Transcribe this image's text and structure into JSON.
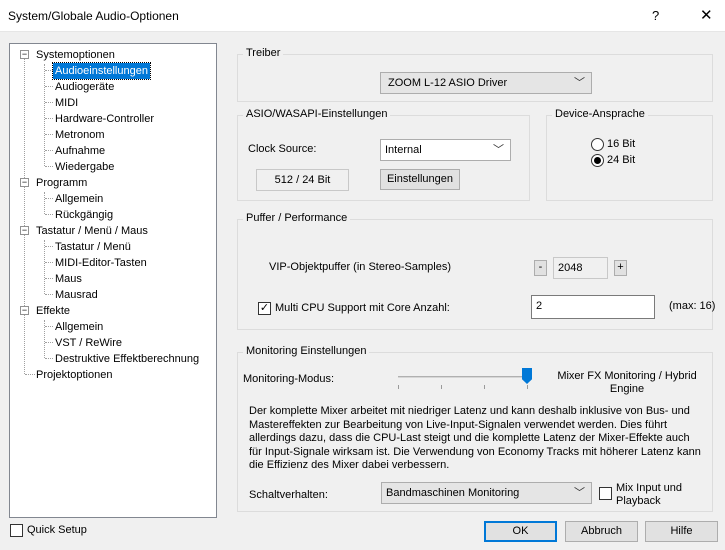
{
  "window": {
    "title": "System/Globale Audio-Optionen",
    "help": "?",
    "close": "✕"
  },
  "tree": {
    "items": [
      {
        "label": "Systemoptionen"
      },
      {
        "label": "Audioeinstellungen"
      },
      {
        "label": "Audiogeräte"
      },
      {
        "label": "MIDI"
      },
      {
        "label": "Hardware-Controller"
      },
      {
        "label": "Metronom"
      },
      {
        "label": "Aufnahme"
      },
      {
        "label": "Wiedergabe"
      },
      {
        "label": "Programm"
      },
      {
        "label": "Allgemein"
      },
      {
        "label": "Rückgängig"
      },
      {
        "label": "Tastatur / Menü / Maus"
      },
      {
        "label": "Tastatur / Menü"
      },
      {
        "label": "MIDI-Editor-Tasten"
      },
      {
        "label": "Maus"
      },
      {
        "label": "Mausrad"
      },
      {
        "label": "Effekte"
      },
      {
        "label": "Allgemein"
      },
      {
        "label": "VST / ReWire"
      },
      {
        "label": "Destruktive Effektberechnung"
      },
      {
        "label": "Projektoptionen"
      }
    ],
    "toggle": "−"
  },
  "treiber": {
    "title": "Treiber",
    "driver": "ZOOM L-12 ASIO Driver"
  },
  "asio": {
    "title": "ASIO/WASAPI-Einstellungen",
    "clock_label": "Clock Source:",
    "clock_value": "Internal",
    "buffer_value": "512 / 24 Bit",
    "settings_button": "Einstellungen"
  },
  "device": {
    "title": "Device-Ansprache",
    "opt16": "16 Bit",
    "opt24": "24 Bit",
    "selected": "24 Bit"
  },
  "puffer": {
    "title": "Puffer / Performance",
    "vip_label": "VIP-Objektpuffer (in Stereo-Samples)",
    "vip_minus": "-",
    "vip_value": "2048",
    "vip_plus": "+",
    "multicpu_label": "Multi CPU Support mit Core Anzahl:",
    "multicpu_checked": "✓",
    "cores_value": "2",
    "max_label": "(max: 16)"
  },
  "monitoring": {
    "title": "Monitoring Einstellungen",
    "mode_label": "Monitoring-Modus:",
    "slider_value_label": "Mixer FX Monitoring / Hybrid Engine",
    "slider_position": 1.0,
    "description": "Der komplette Mixer arbeitet mit niedriger Latenz und kann deshalb inklusive von Bus- und Mastereffekten zur Bearbeitung von Live-Input-Signalen verwendet werden. Dies führt allerdings dazu, dass die CPU-Last steigt und die komplette Latenz der Mixer-Effekte auch für Input-Signale wirksam ist. Die Verwendung von Economy Tracks mit höherer Latenz kann die Effizienz des Mixer dabei verbessern.",
    "schalt_label": "Schaltverhalten:",
    "schalt_value": "Bandmaschinen Monitoring",
    "mix_input_label": "Mix Input und Playback"
  },
  "footer": {
    "quick_setup": "Quick Setup",
    "ok": "OK",
    "abbruch": "Abbruch",
    "hilfe": "Hilfe"
  },
  "colors": {
    "selection": "#0078d7",
    "window_bg": "#f0f0f0",
    "slider_thumb": "#0078d7"
  }
}
